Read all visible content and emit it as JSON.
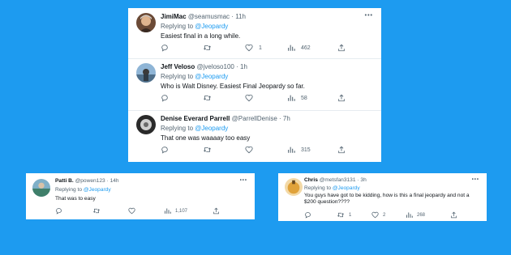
{
  "main_thread": [
    {
      "name": "JimiMac",
      "handle": "@seamusmac",
      "dot": "·",
      "time": "11h",
      "replying_prefix": "Replying to ",
      "replying_to": "@Jeopardy",
      "text": "Easiest final in a long while.",
      "like_count": "1",
      "views_count": "462"
    },
    {
      "name": "Jeff Veloso",
      "handle": "@jveloso100",
      "dot": "·",
      "time": "1h",
      "replying_prefix": "Replying to ",
      "replying_to": "@Jeopardy",
      "text": "Who is Walt Disney.  Easiest Final Jeopardy so far.",
      "views_count": "58"
    },
    {
      "name": "Denise Everard Parrell",
      "handle": "@ParrellDenise",
      "dot": "·",
      "time": "7h",
      "replying_prefix": "Replying to ",
      "replying_to": "@Jeopardy",
      "text": "That one was waaaay too easy",
      "views_count": "315"
    }
  ],
  "patti": {
    "name": "Patti B.",
    "handle": "@powen123",
    "dot": "·",
    "time": "14h",
    "replying_prefix": "Replying to ",
    "replying_to": "@Jeopardy",
    "text": "That was to easy",
    "views_count": "1,107"
  },
  "chris": {
    "name": "Chris",
    "handle": "@metsfan3131",
    "dot": "·",
    "time": "3h",
    "replying_prefix": "Replying to ",
    "replying_to": "@Jeopardy",
    "text": "You guys have got to be kidding, how is this a final jeopardy and not a $200 question????",
    "retweet_count": "1",
    "like_count": "2",
    "views_count": "268"
  },
  "more_glyph": "•••",
  "colors": {
    "background": "#1d9bf0",
    "card": "#ffffff",
    "mention": "#1d9bf0",
    "muted": "#536471"
  },
  "icons": [
    "reply-icon",
    "retweet-icon",
    "like-icon",
    "views-icon",
    "share-icon",
    "more-icon"
  ]
}
